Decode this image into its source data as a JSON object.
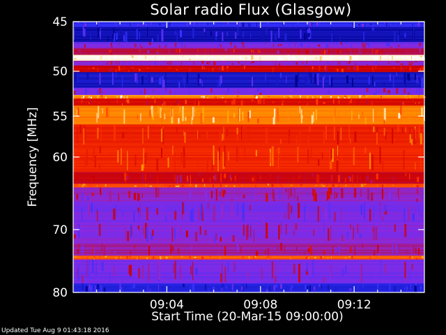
{
  "chart_data": {
    "type": "heatmap",
    "title": "Solar radio Flux (Glasgow)",
    "xlabel": "Start Time (20-Mar-15 09:00:00)",
    "ylabel": "Frequency [MHz]",
    "x_ticks": [
      "09:04",
      "09:08",
      "09:12"
    ],
    "x_tick_values_min": [
      4,
      8,
      12
    ],
    "xlim_min": [
      0,
      15
    ],
    "y_ticks": [
      45,
      50,
      55,
      60,
      70,
      80
    ],
    "ylim_mhz": [
      45,
      80
    ],
    "y_scale": "log",
    "colormap": [
      "#00008b",
      "#3030ff",
      "#8a2be2",
      "#cc0000",
      "#ff3300",
      "#ffa500",
      "#ffffff"
    ],
    "bands": [
      {
        "from": 45.0,
        "to": 45.5,
        "level": 0.15
      },
      {
        "from": 45.5,
        "to": 47.0,
        "level": 0.05
      },
      {
        "from": 47.0,
        "to": 47.6,
        "level": 0.3
      },
      {
        "from": 47.6,
        "to": 48.3,
        "level": 0.45
      },
      {
        "from": 48.3,
        "to": 48.9,
        "level": 0.98
      },
      {
        "from": 48.9,
        "to": 49.4,
        "level": 0.35
      },
      {
        "from": 49.4,
        "to": 50.1,
        "level": 0.5
      },
      {
        "from": 50.1,
        "to": 51.8,
        "level": 0.08
      },
      {
        "from": 51.8,
        "to": 52.6,
        "level": 0.3
      },
      {
        "from": 52.6,
        "to": 53.0,
        "level": 0.8
      },
      {
        "from": 53.0,
        "to": 53.8,
        "level": 0.55
      },
      {
        "from": 53.8,
        "to": 56.0,
        "level": 0.78
      },
      {
        "from": 56.0,
        "to": 58.5,
        "level": 0.6
      },
      {
        "from": 58.5,
        "to": 62.0,
        "level": 0.62
      },
      {
        "from": 62.0,
        "to": 63.5,
        "level": 0.48
      },
      {
        "from": 63.5,
        "to": 64.0,
        "level": 0.7
      },
      {
        "from": 64.0,
        "to": 66.0,
        "level": 0.35
      },
      {
        "from": 66.0,
        "to": 69.0,
        "level": 0.3
      },
      {
        "from": 69.0,
        "to": 72.0,
        "level": 0.33
      },
      {
        "from": 72.0,
        "to": 74.0,
        "level": 0.38
      },
      {
        "from": 74.0,
        "to": 74.6,
        "level": 0.72
      },
      {
        "from": 74.6,
        "to": 78.5,
        "level": 0.3
      },
      {
        "from": 78.5,
        "to": 80.0,
        "level": 0.12
      }
    ]
  },
  "footer": {
    "updated": "Updated Tue Aug  9 01:43:18 2016"
  }
}
